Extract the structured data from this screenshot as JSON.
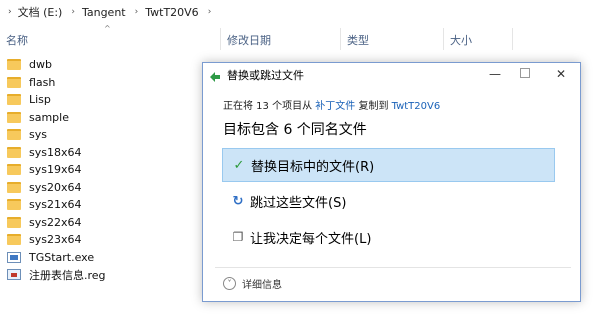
{
  "breadcrumb": {
    "segments": [
      "文档 (E:)",
      "Tangent",
      "TwtT20V6"
    ]
  },
  "columns": {
    "name": "名称",
    "modified": "修改日期",
    "type": "类型",
    "size": "大小"
  },
  "files": [
    {
      "name": "dwb",
      "kind": "folder"
    },
    {
      "name": "flash",
      "kind": "folder"
    },
    {
      "name": "Lisp",
      "kind": "folder"
    },
    {
      "name": "sample",
      "kind": "folder"
    },
    {
      "name": "sys",
      "kind": "folder"
    },
    {
      "name": "sys18x64",
      "kind": "folder"
    },
    {
      "name": "sys19x64",
      "kind": "folder"
    },
    {
      "name": "sys20x64",
      "kind": "folder"
    },
    {
      "name": "sys21x64",
      "kind": "folder"
    },
    {
      "name": "sys22x64",
      "kind": "folder"
    },
    {
      "name": "sys23x64",
      "kind": "folder"
    },
    {
      "name": "TGStart.exe",
      "kind": "exe"
    },
    {
      "name": "注册表信息.reg",
      "kind": "reg"
    }
  ],
  "dialog": {
    "title": "替换或跳过文件",
    "minimize": "—",
    "close": "✕",
    "progress_prefix": "正在将 13 个项目从 ",
    "source": "补丁文件",
    "progress_mid": " 复制到 ",
    "dest": "TwtT20V6",
    "heading": "目标包含 6 个同名文件",
    "options": {
      "replace": "替换目标中的文件(R)",
      "skip": "跳过这些文件(S)",
      "decide": "让我决定每个文件(L)"
    },
    "details": "详细信息"
  }
}
